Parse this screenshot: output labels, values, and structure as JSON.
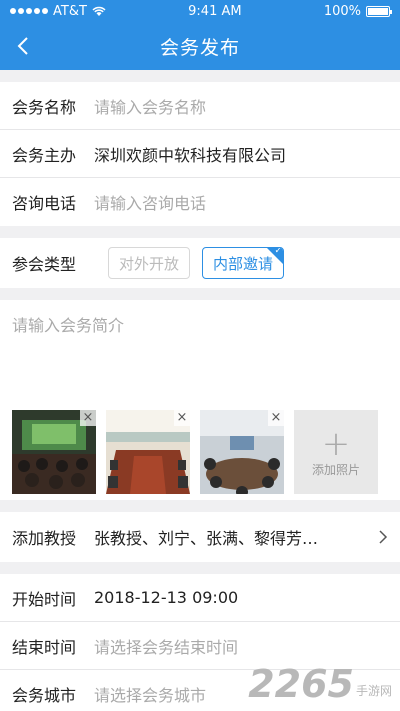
{
  "status": {
    "carrier": "AT&T",
    "time": "9:41 AM",
    "battery": "100%"
  },
  "nav": {
    "title": "会务发布"
  },
  "form": {
    "name_label": "会务名称",
    "name_placeholder": "请输入会务名称",
    "host_label": "会务主办",
    "host_value": "深圳欢颜中软科技有限公司",
    "phone_label": "咨询电话",
    "phone_placeholder": "请输入咨询电话",
    "type_label": "参会类型",
    "type_options": [
      "对外开放",
      "内部邀请"
    ],
    "type_selected": "内部邀请",
    "intro_placeholder": "请输入会务简介",
    "add_photo_label": "添加照片",
    "professor_label": "添加教授",
    "professor_value": "张教授、刘宁、张满、黎得芳…",
    "start_label": "开始时间",
    "start_value": "2018-12-13 09:00",
    "end_label": "结束时间",
    "end_placeholder": "请选择会务结束时间",
    "city_label": "会务城市",
    "city_placeholder": "请选择会务城市"
  },
  "watermark": {
    "number": "2265",
    "text": "手游网"
  },
  "colors": {
    "accent": "#2d8fe3"
  }
}
